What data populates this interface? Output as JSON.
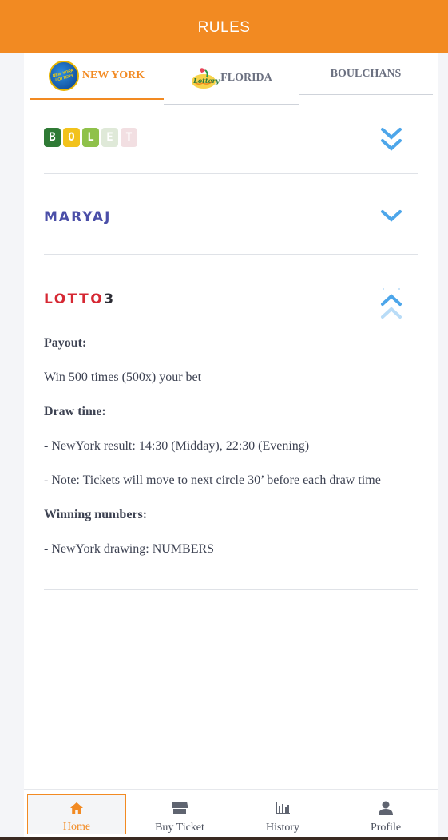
{
  "header": {
    "title": "RULES"
  },
  "tabs": [
    {
      "label": "NEW YORK",
      "logo": "NEW YORK LOTTERY",
      "active": true
    },
    {
      "label": "FLORIDA",
      "logo": "Lottery"
    },
    {
      "label": "BOULCHANS"
    }
  ],
  "sections": {
    "bolet": {
      "logo_letters": [
        "B",
        "O",
        "L",
        "E",
        "T"
      ],
      "logo_colors": [
        "#2f7a35",
        "#f2c21b",
        "#8fc14a",
        "#dfe9d8",
        "#f2dfe2"
      ]
    },
    "maryaj": {
      "logo": "MARYAJ"
    },
    "lotto3": {
      "logo_text": "LOTTO",
      "logo_number": "3",
      "payout_title": "Payout:",
      "payout_text": "Win 500 times (500x) your bet",
      "draw_title": "Draw time:",
      "draw_result": "- NewYork result: 14:30 (Midday), 22:30 (Evening)",
      "draw_note": "- Note: Tickets will move to next circle 30’ before each draw time",
      "winning_title": "Winning numbers:",
      "winning_text": "- NewYork drawing: NUMBERS"
    }
  },
  "bottom_nav": [
    {
      "label": "Home",
      "icon": "home-icon",
      "active": true
    },
    {
      "label": "Buy Ticket",
      "icon": "store-icon"
    },
    {
      "label": "History",
      "icon": "bar-chart-icon"
    },
    {
      "label": "Profile",
      "icon": "user-icon"
    }
  ],
  "colors": {
    "accent": "#f28a22",
    "chevron": "#4da6ea"
  }
}
